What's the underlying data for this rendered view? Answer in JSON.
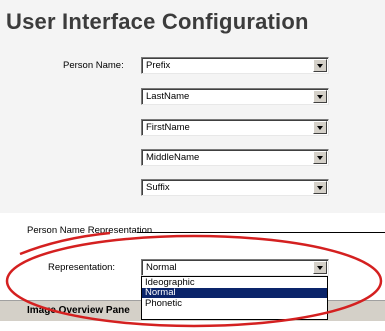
{
  "page": {
    "title": "User Interface Configuration"
  },
  "person_name": {
    "label": "Person Name:",
    "fields": [
      {
        "value": "Prefix"
      },
      {
        "value": "LastName"
      },
      {
        "value": "FirstName"
      },
      {
        "value": "MiddleName"
      },
      {
        "value": "Suffix"
      }
    ]
  },
  "representation_section": {
    "heading": "Person Name Representation",
    "label": "Representation:",
    "selected": "Normal",
    "options": [
      "Ideographic",
      "Normal",
      "Phonetic"
    ],
    "highlighted_option": "Normal"
  },
  "image_overview": {
    "title": "Image Overview Pane"
  },
  "annotation": {
    "color": "#d42020",
    "shape": "ellipse"
  }
}
